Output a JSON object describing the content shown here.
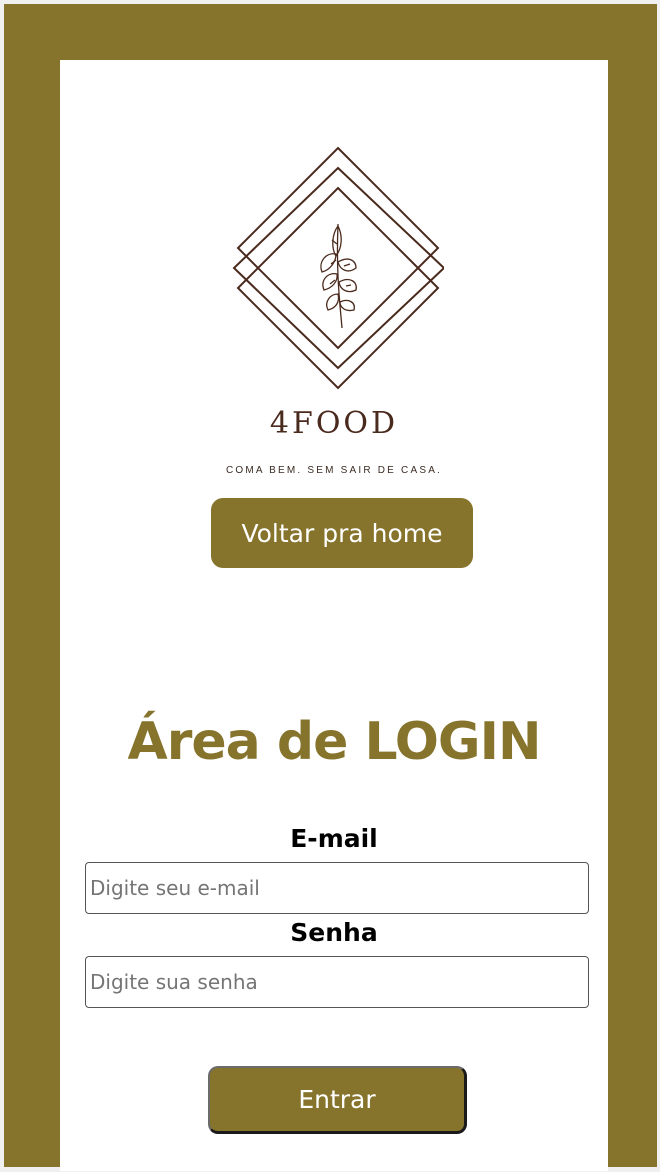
{
  "brand": {
    "name": "4FOOD",
    "tagline": "COMA BEM. SEM SAIR DE CASA."
  },
  "nav": {
    "home_label": "Voltar pra home"
  },
  "login": {
    "title": "Área de LOGIN",
    "email_label": "E-mail",
    "email_placeholder": "Digite seu e-mail",
    "password_label": "Senha",
    "password_placeholder": "Digite sua senha",
    "submit_label": "Entrar"
  },
  "colors": {
    "accent": "#86742c",
    "logo": "#4a2a1d",
    "background": "#ffffff"
  },
  "icons": {
    "logo": "wheat-sprig-diamond-logo"
  }
}
